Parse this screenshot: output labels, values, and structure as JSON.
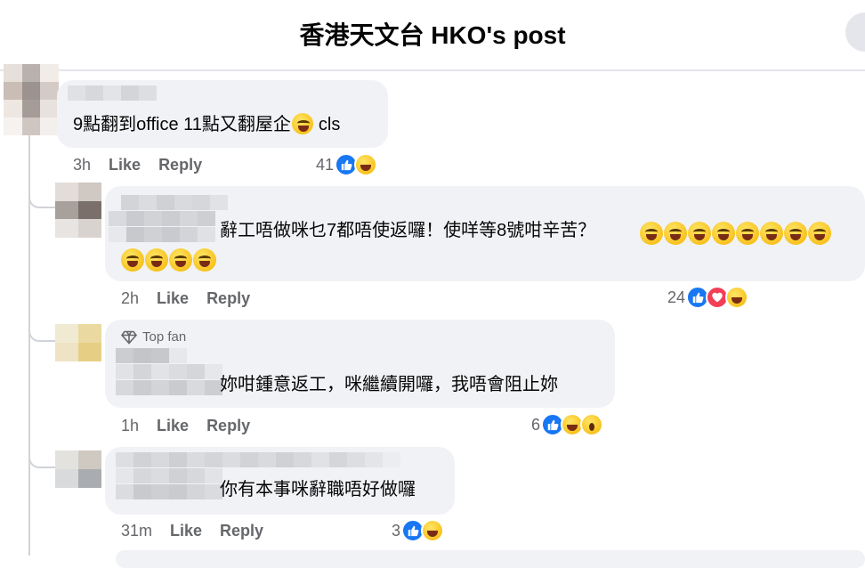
{
  "header": {
    "title": "香港天文台 HKO's post"
  },
  "comments": [
    {
      "text": "9點翻到office 11點又翻屋企",
      "text_after": "cls",
      "time": "3h",
      "like": "Like",
      "reply": "Reply",
      "count": "41",
      "reactions": [
        "like-icon",
        "haha-icon"
      ]
    },
    {
      "text": "辭工唔做咪乜7都唔使返囉！使咩等8號咁辛苦？",
      "emoji_count": 12,
      "time": "2h",
      "like": "Like",
      "reply": "Reply",
      "count": "24",
      "reactions": [
        "like-icon",
        "love-icon",
        "haha-icon"
      ]
    },
    {
      "badge": "Top fan",
      "text": "妳咁鍾意返工，咪繼續開囉，我唔會阻止妳",
      "time": "1h",
      "like": "Like",
      "reply": "Reply",
      "count": "6",
      "reactions": [
        "like-icon",
        "haha-icon",
        "wow-icon"
      ]
    },
    {
      "text": "你有本事咪辭職唔好做囉",
      "time": "31m",
      "like": "Like",
      "reply": "Reply",
      "count": "3",
      "reactions": [
        "like-icon",
        "haha-icon"
      ]
    }
  ],
  "colors": {
    "like": "#1877f2",
    "love": "#f33e58",
    "bubble": "#f0f2f5",
    "meta": "#65676b"
  }
}
